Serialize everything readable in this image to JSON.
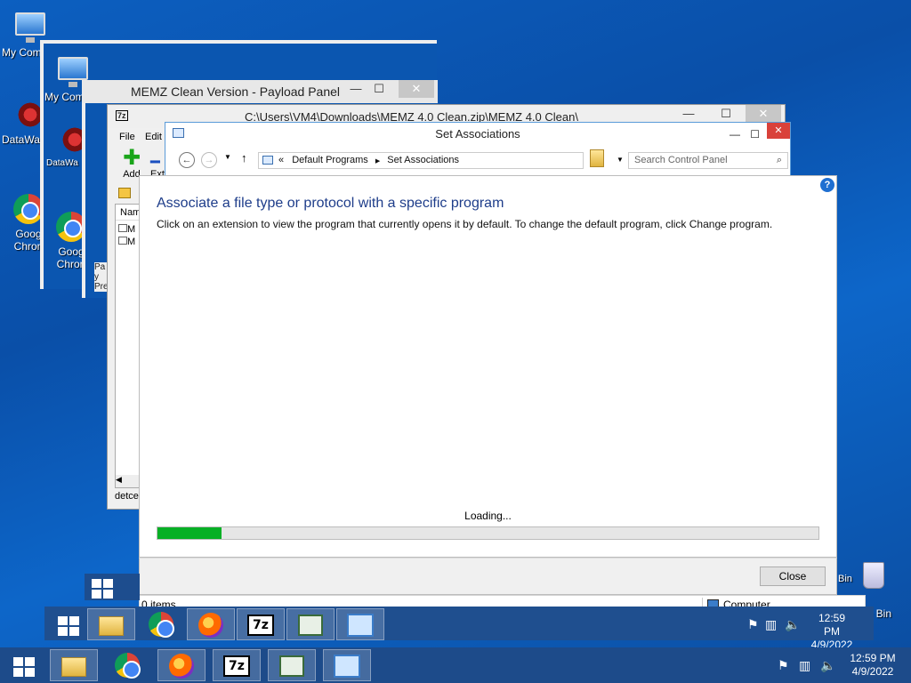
{
  "desktop": {
    "icons": [
      {
        "label": "My Com"
      },
      {
        "label": "DataWa"
      },
      {
        "label": "Goog Chron"
      },
      {
        "label": "My Com"
      },
      {
        "label": "DataWa"
      },
      {
        "label": "Goog Chron"
      },
      {
        "label": "cle Bin"
      },
      {
        "label": "Bin"
      }
    ]
  },
  "payload_window": {
    "title": "MEMZ Clean Version - Payload Panel",
    "sidebar_fragment": "Pay Pre"
  },
  "zip_window": {
    "title": "C:\\Users\\VM4\\Downloads\\MEMZ 4.0 Clean.zip\\MEMZ 4.0 Clean\\",
    "menu": [
      "File",
      "Edit"
    ],
    "toolbar": {
      "add": "Add",
      "extract": "Extr"
    },
    "column_name": "Nam",
    "rows": [
      "M",
      "M"
    ],
    "status": "detce"
  },
  "assoc_window": {
    "title": "Set Associations",
    "breadcrumb_prefix": "«",
    "breadcrumb": [
      "Default Programs",
      "Set Associations"
    ],
    "search_placeholder": "Search Control Panel",
    "heading": "Associate a file type or protocol with a specific program",
    "description": "Click on an extension to view the program that currently opens it by default. To change the default program, click Change program.",
    "loading": "Loading...",
    "progress": 0.097,
    "close_label": "Close",
    "status_items": "0 items",
    "status_computer": "Computer"
  },
  "taskbar_lower": {
    "time": "12:59 PM",
    "date": "4/9/2022"
  },
  "taskbar_upper": {
    "time": "12:59 PM",
    "date": "4/9/2022"
  },
  "colors": {
    "progress_fill": "#06b025",
    "heading": "#1e3d8a",
    "close_red": "#d9413a"
  }
}
